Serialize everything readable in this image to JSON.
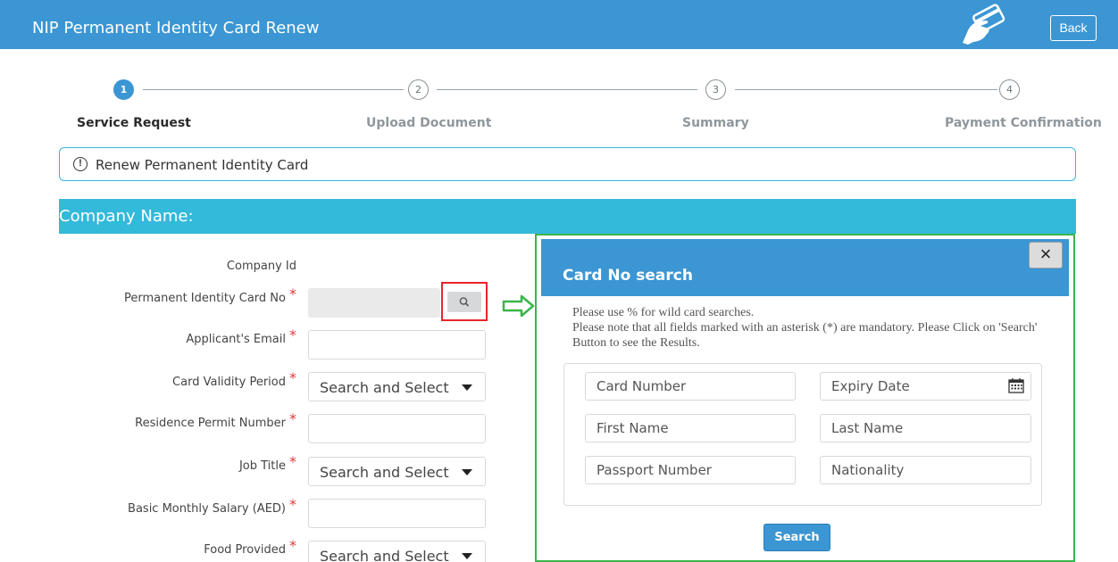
{
  "header": {
    "title": "NIP Permanent Identity Card Renew",
    "back_label": "Back",
    "icons": [
      "card-hand-icon"
    ]
  },
  "stepper": {
    "steps": [
      {
        "number": "1",
        "label": "Service Request",
        "active": true
      },
      {
        "number": "2",
        "label": "Upload Document",
        "active": false
      },
      {
        "number": "3",
        "label": "Summary",
        "active": false
      },
      {
        "number": "4",
        "label": "Payment Confirmation",
        "active": false
      }
    ]
  },
  "info": {
    "icon": "!",
    "text": "Renew Permanent Identity Card"
  },
  "company": {
    "title": "Company Name:"
  },
  "form": {
    "required_mark": "*",
    "company_id_label": "Company Id",
    "card_no_label": "Permanent Identity Card No",
    "email_label": "Applicant's Email",
    "validity_label": "Card Validity Period",
    "validity_value": "Search and Select",
    "residence_label": "Residence Permit Number",
    "job_label": "Job Title",
    "job_value": "Search and Select",
    "salary_label": "Basic Monthly Salary (AED)",
    "food_label": "Food Provided",
    "food_value": "Search and Select"
  },
  "modal": {
    "title": "Card No search",
    "close_label": "×",
    "note_line1": "Please use % for wild card searches.",
    "note_line2": "Please note that all fields marked with an asterisk (*) are mandatory. Please Click on 'Search' Button to see the Results.",
    "fields": {
      "card_number": "Card Number",
      "expiry_date": "Expiry Date",
      "first_name": "First Name",
      "last_name": "Last Name",
      "passport_number": "Passport Number",
      "nationality": "Nationality"
    },
    "search_label": "Search"
  },
  "colors": {
    "header_blue": "#3b96d3",
    "company_bar": "#33b9da",
    "required": "#e03a3a",
    "highlight_red": "#e8262a",
    "highlight_green": "#3ab54a"
  }
}
